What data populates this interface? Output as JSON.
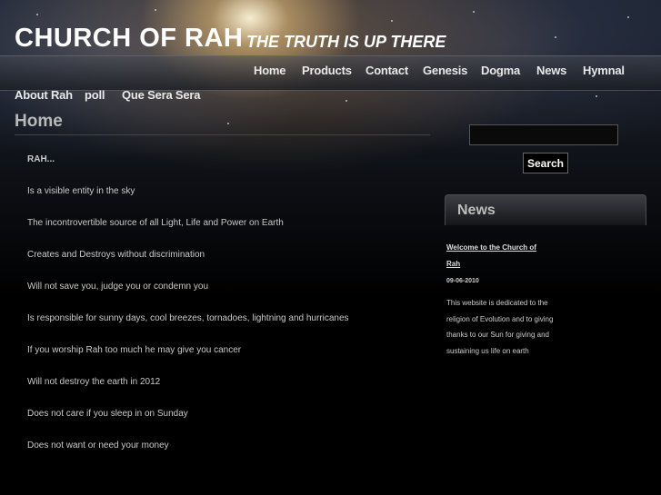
{
  "header": {
    "site_title": "CHURCH OF RAH",
    "tagline": "THE TRUTH IS UP THERE"
  },
  "nav": {
    "top_row": [
      "Home",
      "Products",
      "Contact",
      "Genesis",
      "Dogma",
      "News",
      "Hymnal"
    ],
    "second_row": [
      "About Rah",
      "poll",
      "Que Sera Sera"
    ]
  },
  "main": {
    "page_title": "Home",
    "lines": [
      "RAH...",
      "Is a visible entity in the sky",
      "The incontrovertible source of all Light, Life and Power on Earth",
      "Creates and Destroys without discrimination",
      "Will not save you, judge you or condemn you",
      "Is responsible for sunny days, cool breezes, tornadoes, lightning and hurricanes",
      "If you worship Rah too much he may give you cancer",
      "Will not destroy the earth in 2012",
      "Does not care if you sleep in on Sunday",
      "Does not want or need your money"
    ]
  },
  "sidebar": {
    "search": {
      "value": "",
      "placeholder": "",
      "button_label": "Search"
    },
    "news": {
      "title": "News",
      "headline": "Welcome to the Church of Rah",
      "date": "09-06-2010",
      "body": "This website is dedicated to the religion of Evolution and to giving thanks to our Sun for giving and sustaining us life on earth"
    }
  }
}
